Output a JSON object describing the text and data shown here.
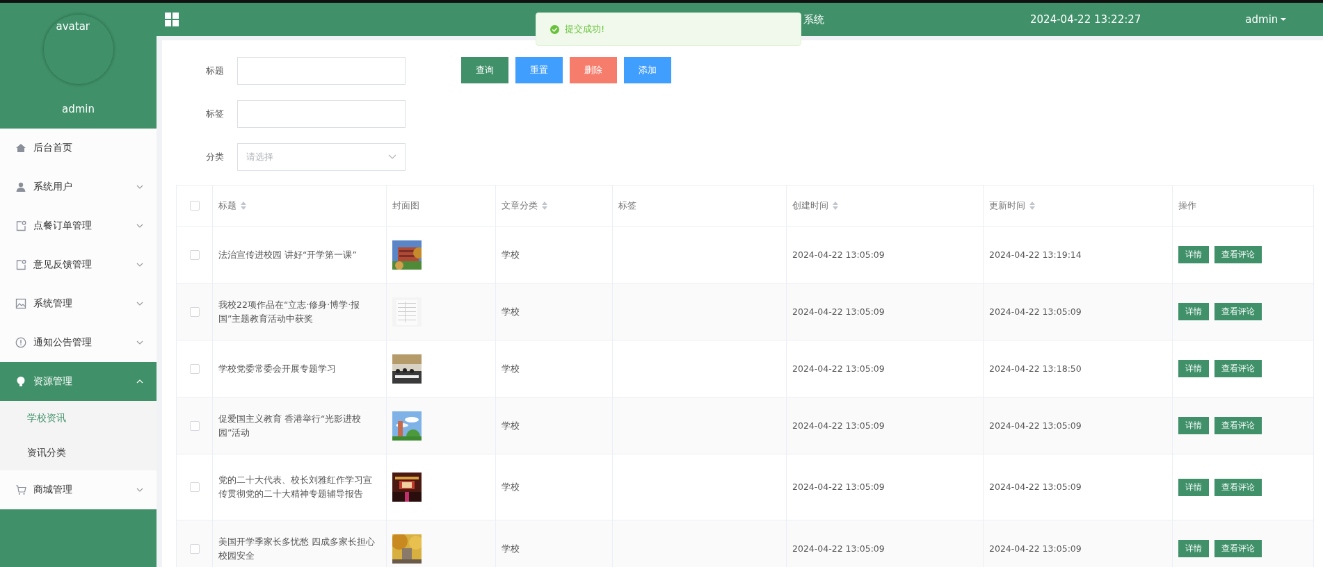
{
  "sidebar": {
    "avatar_label": "avatar",
    "username": "admin",
    "items": [
      {
        "label": "后台首页",
        "kind": "link"
      },
      {
        "label": "系统用户",
        "kind": "group",
        "expanded": false
      },
      {
        "label": "点餐订单管理",
        "kind": "group",
        "expanded": false
      },
      {
        "label": "意见反馈管理",
        "kind": "group",
        "expanded": false
      },
      {
        "label": "系统管理",
        "kind": "group",
        "expanded": false
      },
      {
        "label": "通知公告管理",
        "kind": "group",
        "expanded": false
      },
      {
        "label": "资源管理",
        "kind": "group",
        "expanded": true,
        "children": [
          {
            "label": "学校资讯",
            "selected": true
          },
          {
            "label": "资讯分类",
            "selected": false
          }
        ]
      },
      {
        "label": "商城管理",
        "kind": "group",
        "expanded": false
      }
    ]
  },
  "topbar": {
    "title": "系统",
    "datetime": "2024-04-22 13:22:27",
    "user": "admin"
  },
  "toast": {
    "message": "提交成功!"
  },
  "filters": [
    {
      "label": "标题",
      "kind": "text"
    },
    {
      "label": "标签",
      "kind": "text"
    },
    {
      "label": "分类",
      "kind": "select",
      "placeholder": "请选择"
    }
  ],
  "buttons": [
    {
      "label": "查询",
      "color": "#40916a"
    },
    {
      "label": "重置",
      "color": "#409eff"
    },
    {
      "label": "删除",
      "color": "#f67c6c"
    },
    {
      "label": "添加",
      "color": "#409eff"
    }
  ],
  "table": {
    "select_all": {
      "checked": false
    },
    "columns": [
      {
        "label": "标题",
        "sortable": true
      },
      {
        "label": "封面图",
        "sortable": false
      },
      {
        "label": "文章分类",
        "sortable": true
      },
      {
        "label": "标签",
        "sortable": false
      },
      {
        "label": "创建时间",
        "sortable": true
      },
      {
        "label": "更新时间",
        "sortable": true
      },
      {
        "label": "操作",
        "sortable": false
      }
    ],
    "rows": [
      {
        "checked": false,
        "title": "法治宣传进校园 讲好“开学第一课”",
        "cover": {
          "kind": "picture"
        },
        "category": "学校",
        "created": "2024-04-22 13:05:09",
        "updated": "2024-04-22 13:19:14",
        "actions": [
          "详情",
          "查看评论"
        ]
      },
      {
        "checked": false,
        "title": "我校22项作品在“立志·修身·博学·报国”主题教育活动中获奖",
        "cover": {
          "kind": "picture"
        },
        "category": "学校",
        "created": "2024-04-22 13:05:09",
        "updated": "2024-04-22 13:05:09",
        "actions": [
          "详情",
          "查看评论"
        ]
      },
      {
        "checked": false,
        "title": "学校党委常委会开展专题学习",
        "cover": {
          "kind": "picture"
        },
        "category": "学校",
        "created": "2024-04-22 13:05:09",
        "updated": "2024-04-22 13:18:50",
        "actions": [
          "详情",
          "查看评论"
        ]
      },
      {
        "checked": false,
        "title": "促爱国主义教育 香港举行“光影进校园”活动",
        "cover": {
          "kind": "picture"
        },
        "category": "学校",
        "created": "2024-04-22 13:05:09",
        "updated": "2024-04-22 13:05:09",
        "actions": [
          "详情",
          "查看评论"
        ]
      },
      {
        "checked": false,
        "title": "党的二十大代表、校长刘雅红作学习宣传贯彻党的二十大精神专题辅导报告",
        "cover": {
          "kind": "picture"
        },
        "category": "学校",
        "created": "2024-04-22 13:05:09",
        "updated": "2024-04-22 13:05:09",
        "actions": [
          "详情",
          "查看评论"
        ]
      },
      {
        "checked": false,
        "title": "美国开学季家长多忧愁 四成多家长担心校园安全",
        "cover": {
          "kind": "picture"
        },
        "category": "学校",
        "created": "2024-04-22 13:05:09",
        "updated": "2024-04-22 13:05:09",
        "actions": [
          "详情",
          "查看评论"
        ]
      }
    ]
  }
}
